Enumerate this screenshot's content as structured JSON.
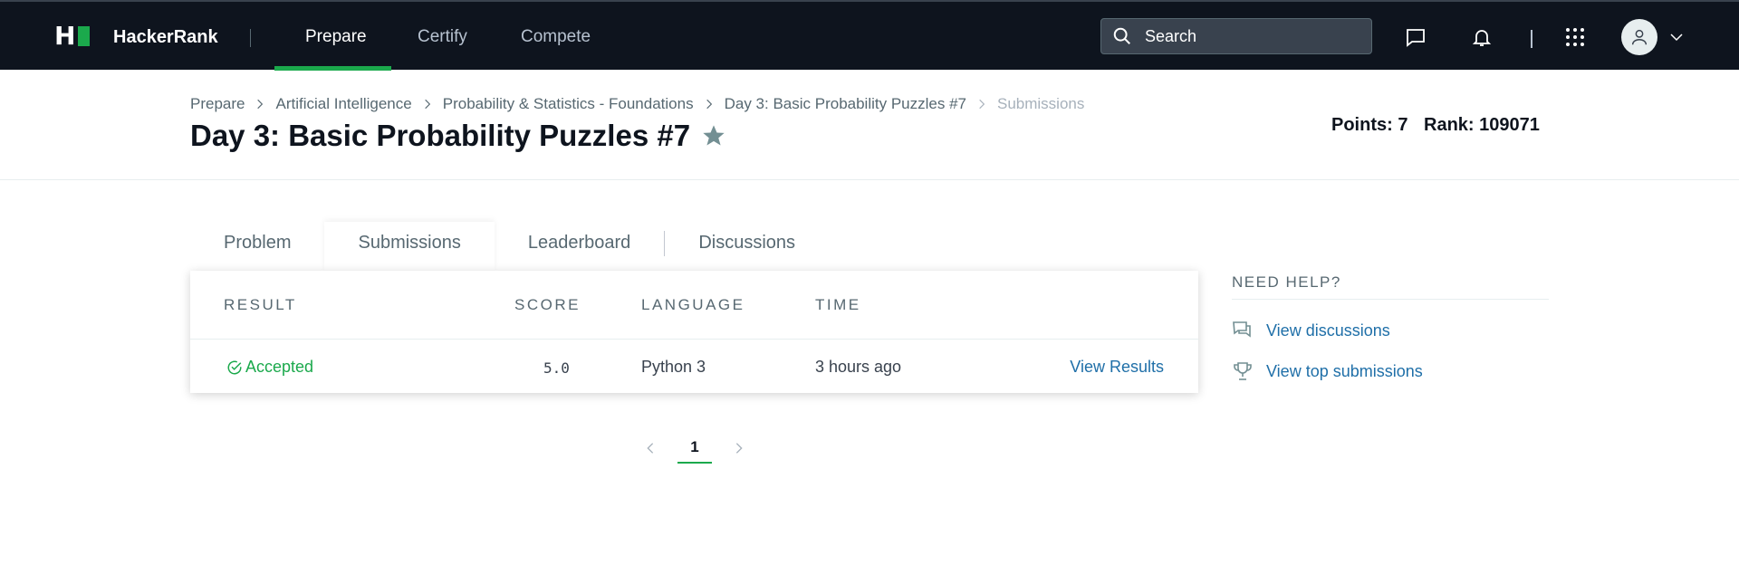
{
  "nav": {
    "logo_letter": "H",
    "brand": "HackerRank",
    "links": [
      "Prepare",
      "Certify",
      "Compete"
    ],
    "active_link": "Prepare",
    "search_placeholder": "Search",
    "icons": [
      "chat-icon",
      "bell-icon",
      "apps-grid-icon",
      "user-avatar-icon",
      "chevron-down-icon"
    ]
  },
  "breadcrumb": [
    "Prepare",
    "Artificial Intelligence",
    "Probability & Statistics - Foundations",
    "Day 3: Basic Probability Puzzles #7",
    "Submissions"
  ],
  "title": "Day 3: Basic Probability Puzzles #7",
  "stats": {
    "points": "Points: 7",
    "rank": "Rank: 109071"
  },
  "tabs": [
    "Problem",
    "Submissions",
    "Leaderboard",
    "Discussions"
  ],
  "active_tab": "Submissions",
  "table": {
    "headers": [
      "RESULT",
      "SCORE",
      "LANGUAGE",
      "TIME"
    ],
    "rows": [
      {
        "result": "Accepted",
        "score": "5.0",
        "language": "Python 3",
        "time": "3 hours ago",
        "action": "View Results"
      }
    ]
  },
  "pagination": {
    "current": "1"
  },
  "help": {
    "title": "NEED HELP?",
    "links": [
      "View discussions",
      "View top submissions"
    ]
  },
  "colors": {
    "nav_bg": "#0e141e",
    "accent_green": "#1ba94c",
    "link_blue": "#1f6fa8"
  }
}
